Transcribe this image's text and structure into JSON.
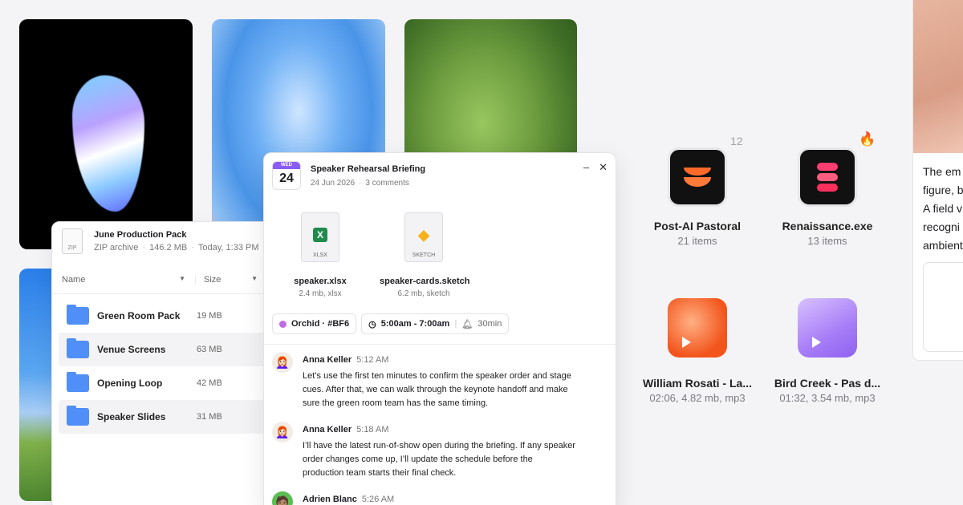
{
  "apps": [
    {
      "name": "Post-AI Pastoral",
      "sub": "21 items",
      "badge": "12",
      "icon": "stack-halves-icon"
    },
    {
      "name": "Renaissance.exe",
      "sub": "13 items",
      "badge": "🔥",
      "icon": "stack-pills-icon"
    },
    {
      "name": "William Rosati - La...",
      "sub": "02:06, 4.82 mb, mp3",
      "icon": "play-icon",
      "color": "#f2541b"
    },
    {
      "name": "Bird Creek - Pas d...",
      "sub": "01:32, 3.54 mb, mp3",
      "icon": "play-icon",
      "color": "#a77df7"
    }
  ],
  "file_manager": {
    "title": "June Production Pack",
    "type": "ZIP archive",
    "size": "146.2 MB",
    "modified": "Today, 1:33 PM",
    "zip_label": "ZIP",
    "col_name": "Name",
    "col_size": "Size",
    "rows": [
      {
        "name": "Green Room Pack",
        "size": "19 MB"
      },
      {
        "name": "Venue Screens",
        "size": "63 MB"
      },
      {
        "name": "Opening Loop",
        "size": "42 MB"
      },
      {
        "name": "Speaker Slides",
        "size": "31 MB"
      }
    ]
  },
  "event": {
    "cal_weekday": "WED",
    "cal_day": "24",
    "title": "Speaker Rehearsal Briefing",
    "date": "24 Jun 2026",
    "comments": "3 comments",
    "attachments": [
      {
        "name": "speaker.xlsx",
        "sub": "2.4 mb, xlsx",
        "ext": "XLSX",
        "glyph": "X",
        "color": "#1f8a4c"
      },
      {
        "name": "speaker-cards.sketch",
        "sub": "6.2 mb, sketch",
        "ext": "SKETCH",
        "glyph": "◆",
        "color": "#f7b21b"
      }
    ],
    "tag": "Orchid · #BF6",
    "time_range": "5:00am - 7:00am",
    "reminder": "30min",
    "messages": [
      {
        "author": "Anna Keller",
        "time": "5:12 AM",
        "text": "Let’s use the first ten minutes to confirm the speaker order and stage cues. After that, we can walk through the keynote handoff and make sure the green room team has the same timing."
      },
      {
        "author": "Anna Keller",
        "time": "5:18 AM",
        "text": "I’ll have the latest run-of-show open during the briefing. If any speaker order changes come up, I’ll update the schedule before the production team starts their final check."
      },
      {
        "author": "Adrien Blanc",
        "time": "5:26 AM",
        "text": ""
      }
    ]
  },
  "side_card": {
    "lines": [
      "The em",
      "figure, b",
      "A field v",
      "recogni",
      "ambient"
    ]
  }
}
